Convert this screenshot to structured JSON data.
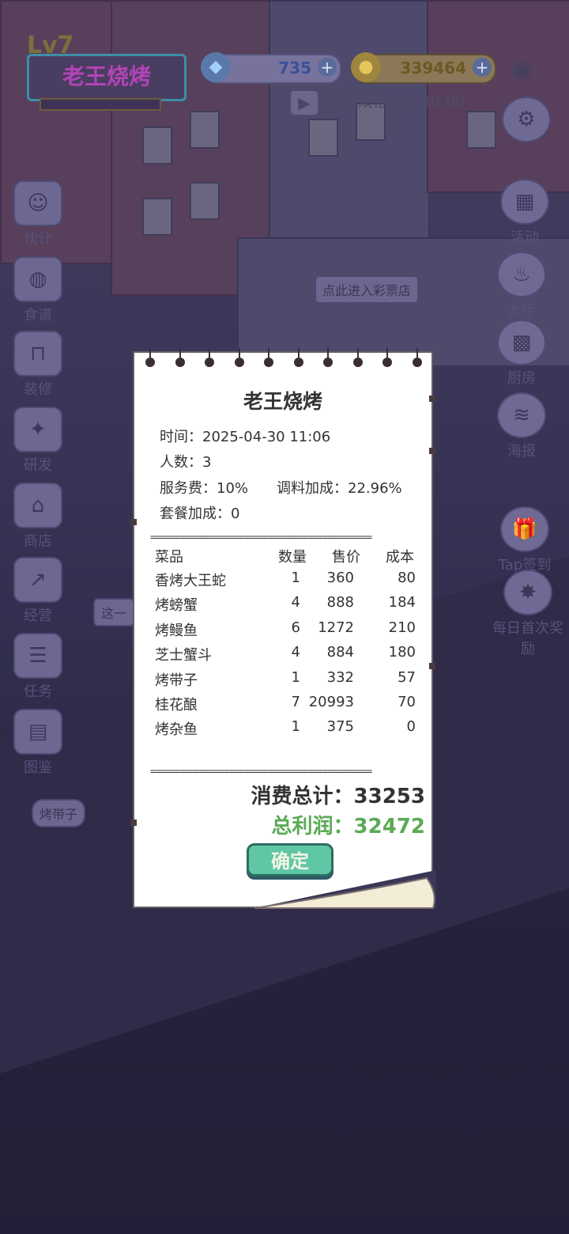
{
  "hud": {
    "level": "Lv7",
    "shop_name": "老王烧烤",
    "gems": "735",
    "coins": "339464",
    "plus": "+",
    "review_double": "好评双倍：0:00:00"
  },
  "left_menu": [
    "伙计",
    "食谱",
    "装修",
    "研发",
    "商店",
    "经营",
    "任务",
    "图鉴"
  ],
  "right_menu": [
    "活动",
    "大厅",
    "厨房",
    "海报"
  ],
  "scene_texts": {
    "lottery_sign": "点此进入彩票店",
    "tap_sign": "Tap签到",
    "daily_reward": "每日首次奖励",
    "bubble_left": "这一",
    "bubble_dish": "烤带子"
  },
  "receipt": {
    "title": "老王烧烤",
    "time_label": "时间：",
    "time_value": "2025-04-30 11:06",
    "people_label": "人数：",
    "people_value": "3",
    "service_label": "服务费：",
    "service_value": "10%",
    "seasoning_label": "调料加成：",
    "seasoning_value": "22.96%",
    "combo_label": "套餐加成：",
    "combo_value": "0",
    "separator": "=============================================",
    "headers": {
      "dish": "菜品",
      "qty": "数量",
      "price": "售价",
      "cost": "成本"
    },
    "rows": [
      {
        "dish": "香烤大王蛇",
        "qty": "1",
        "price": "360",
        "cost": "80"
      },
      {
        "dish": "烤螃蟹",
        "qty": "4",
        "price": "888",
        "cost": "184"
      },
      {
        "dish": "烤鳗鱼",
        "qty": "6",
        "price": "1272",
        "cost": "210"
      },
      {
        "dish": "芝士蟹斗",
        "qty": "4",
        "price": "884",
        "cost": "180"
      },
      {
        "dish": "烤带子",
        "qty": "1",
        "price": "332",
        "cost": "57"
      },
      {
        "dish": "桂花酿",
        "qty": "7",
        "price": "20993",
        "cost": "70"
      },
      {
        "dish": "烤杂鱼",
        "qty": "1",
        "price": "375",
        "cost": "0"
      }
    ],
    "total_label": "消费总计：",
    "total_value": "33253",
    "profit_label": "总利润：",
    "profit_value": "32472",
    "confirm_label": "确定"
  },
  "colors": {
    "total": "#333333",
    "profit": "#5aaa55",
    "confirm_bg": "#5fc7a4"
  }
}
